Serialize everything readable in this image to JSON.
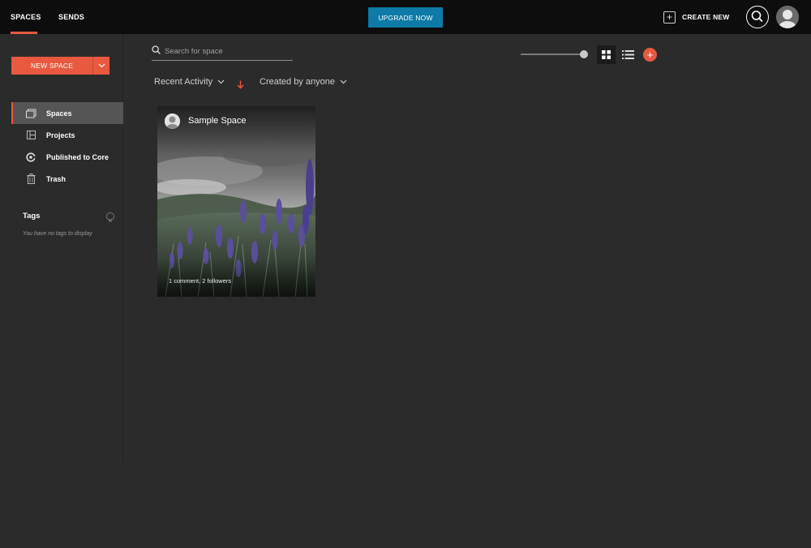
{
  "topbar": {
    "tabs": [
      {
        "label": "SPACES",
        "active": true
      },
      {
        "label": "SENDS",
        "active": false
      }
    ],
    "upgrade_label": "UPGRADE NOW",
    "create_new_label": "CREATE NEW"
  },
  "sidebar": {
    "new_space_label": "NEW SPACE",
    "items": [
      {
        "label": "Spaces",
        "icon": "spaces-icon",
        "active": true
      },
      {
        "label": "Projects",
        "icon": "projects-icon",
        "active": false
      },
      {
        "label": "Published to Core",
        "icon": "core-icon",
        "active": false
      },
      {
        "label": "Trash",
        "icon": "trash-icon",
        "active": false
      }
    ],
    "tags_title": "Tags",
    "tags_empty": "You have no tags to display"
  },
  "main": {
    "search_placeholder": "Search for space",
    "filters": {
      "activity": "Recent Activity",
      "creator": "Created by anyone"
    },
    "cards": [
      {
        "title": "Sample Space",
        "meta": "1 comment, 2 followers"
      }
    ]
  },
  "colors": {
    "accent": "#e8593f",
    "upgrade": "#0d7aa7",
    "topbar": "#0d0d0d",
    "background": "#2b2b2b"
  }
}
